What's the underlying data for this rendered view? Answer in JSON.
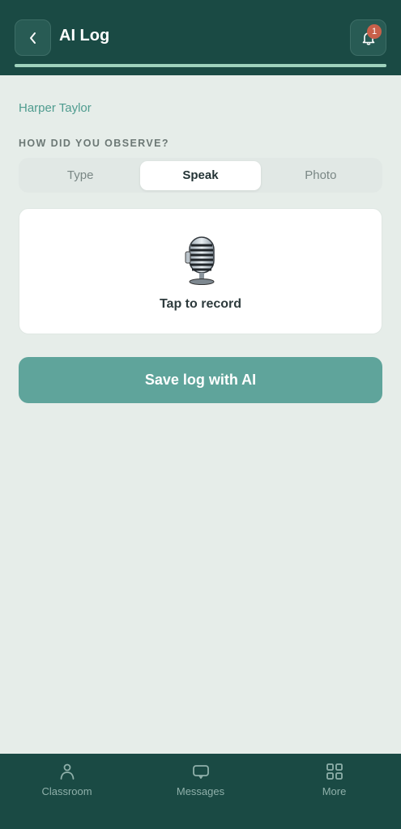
{
  "header": {
    "title": "AI Log",
    "notification_count": "1",
    "progress": 1.0,
    "back_icon": "chevron-left-icon",
    "bell_icon": "bell-icon"
  },
  "student_name": "Harper Taylor",
  "observe": {
    "label": "HOW DID YOU OBSERVE?",
    "options": [
      "Type",
      "Speak",
      "Photo"
    ],
    "selected": "Speak"
  },
  "recorder": {
    "icon": "microphone-icon",
    "label": "Tap to record"
  },
  "save_button": "Save log with AI",
  "bottom_nav": {
    "items": [
      {
        "label": "Classroom",
        "icon": "person-icon"
      },
      {
        "label": "Messages",
        "icon": "chat-bubble-icon"
      },
      {
        "label": "More",
        "icon": "grid-icon"
      }
    ]
  },
  "colors": {
    "header_bg": "#1a4a44",
    "accent": "#5fa49b",
    "page_bg": "#e6ede9",
    "badge": "#c8604a"
  }
}
